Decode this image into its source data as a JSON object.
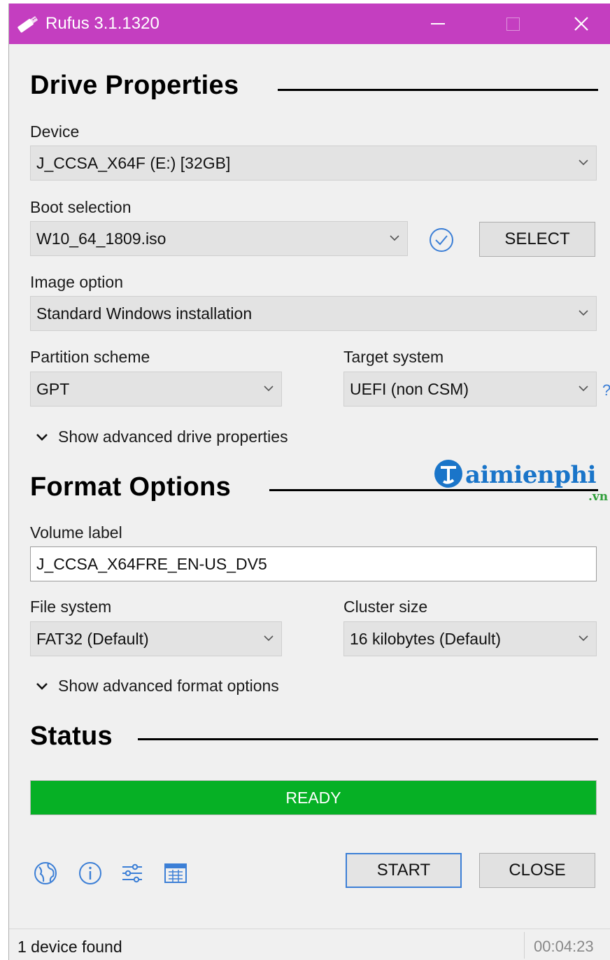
{
  "window": {
    "title": "Rufus 3.1.1320"
  },
  "drive_properties": {
    "heading": "Drive Properties",
    "device_label": "Device",
    "device_value": "J_CCSA_X64F (E:) [32GB]",
    "boot_label": "Boot selection",
    "boot_value": "W10_64_1809.iso",
    "select_button": "SELECT",
    "image_option_label": "Image option",
    "image_option_value": "Standard Windows installation",
    "partition_label": "Partition scheme",
    "partition_value": "GPT",
    "target_label": "Target system",
    "target_value": "UEFI (non CSM)",
    "help_glyph": "?",
    "advanced_toggle": "Show advanced drive properties"
  },
  "format_options": {
    "heading": "Format Options",
    "volume_label_label": "Volume label",
    "volume_label_value": "J_CCSA_X64FRE_EN-US_DV5",
    "filesystem_label": "File system",
    "filesystem_value": "FAT32 (Default)",
    "cluster_label": "Cluster size",
    "cluster_value": "16 kilobytes (Default)",
    "advanced_toggle": "Show advanced format options"
  },
  "status": {
    "heading": "Status",
    "progress_text": "READY",
    "progress_fraction": 1.0,
    "progress_color": "#06b025"
  },
  "toolbar": {
    "icons": [
      "globe-icon",
      "info-icon",
      "settings-sliders-icon",
      "log-icon"
    ],
    "start_button": "START",
    "close_button": "CLOSE"
  },
  "statusbar": {
    "message": "1 device found",
    "elapsed": "00:04:23"
  },
  "watermark": {
    "text": "aimienphi",
    "suffix": ".vn"
  },
  "colors": {
    "titlebar": "#c43ec0",
    "accent": "#3c7fd6"
  }
}
